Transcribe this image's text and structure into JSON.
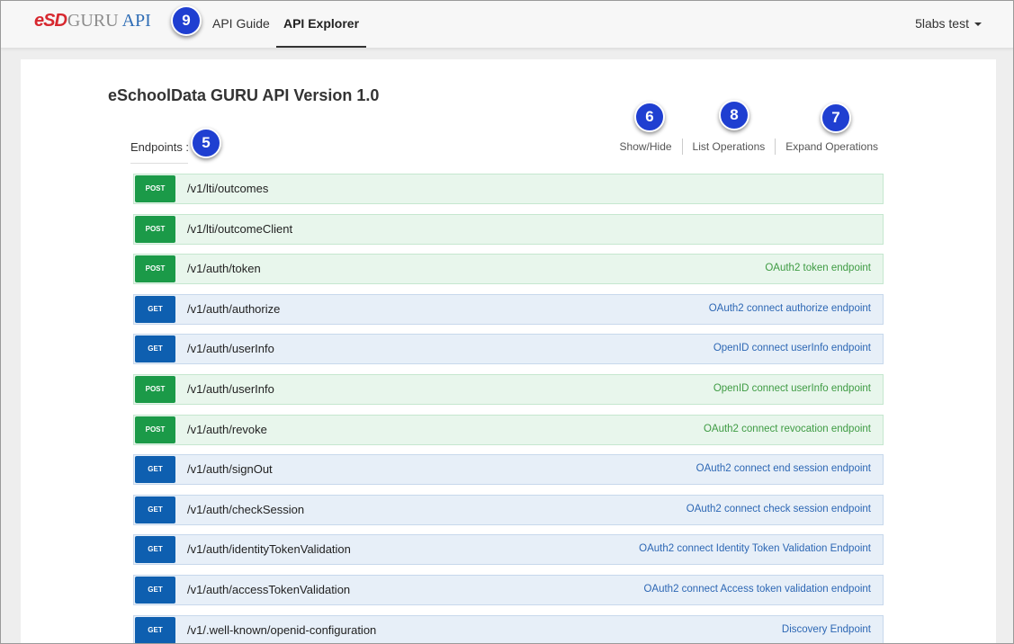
{
  "navbar": {
    "logo": {
      "esd": "eSD",
      "guru": "GURU",
      "api": "API"
    },
    "links": [
      {
        "label": "API Guide",
        "active": false
      },
      {
        "label": "API Explorer",
        "active": true
      }
    ],
    "user": "5labs test"
  },
  "markers": {
    "m5": "5",
    "m6": "6",
    "m7": "7",
    "m8": "8",
    "m9": "9"
  },
  "page": {
    "title": "eSchoolData GURU API Version 1.0",
    "endpoints_label": "Endpoints :",
    "op_links": {
      "show_hide": "Show/Hide",
      "list": "List Operations",
      "expand": "Expand Operations"
    }
  },
  "endpoints": [
    {
      "method": "POST",
      "path": "/v1/lti/outcomes",
      "desc": ""
    },
    {
      "method": "POST",
      "path": "/v1/lti/outcomeClient",
      "desc": ""
    },
    {
      "method": "POST",
      "path": "/v1/auth/token",
      "desc": "OAuth2 token endpoint"
    },
    {
      "method": "GET",
      "path": "/v1/auth/authorize",
      "desc": "OAuth2 connect authorize endpoint"
    },
    {
      "method": "GET",
      "path": "/v1/auth/userInfo",
      "desc": "OpenID connect userInfo endpoint"
    },
    {
      "method": "POST",
      "path": "/v1/auth/userInfo",
      "desc": "OpenID connect userInfo endpoint"
    },
    {
      "method": "POST",
      "path": "/v1/auth/revoke",
      "desc": "OAuth2 connect revocation endpoint"
    },
    {
      "method": "GET",
      "path": "/v1/auth/signOut",
      "desc": "OAuth2 connect end session endpoint"
    },
    {
      "method": "GET",
      "path": "/v1/auth/checkSession",
      "desc": "OAuth2 connect check session endpoint"
    },
    {
      "method": "GET",
      "path": "/v1/auth/identityTokenValidation",
      "desc": "OAuth2 connect Identity Token Validation Endpoint"
    },
    {
      "method": "GET",
      "path": "/v1/auth/accessTokenValidation",
      "desc": "OAuth2 connect Access token validation endpoint"
    },
    {
      "method": "GET",
      "path": "/v1/.well-known/openid-configuration",
      "desc": "Discovery Endpoint"
    }
  ],
  "colors": {
    "post": "#1b9a48",
    "get": "#0e5fb0",
    "marker": "#1f3fd1"
  }
}
